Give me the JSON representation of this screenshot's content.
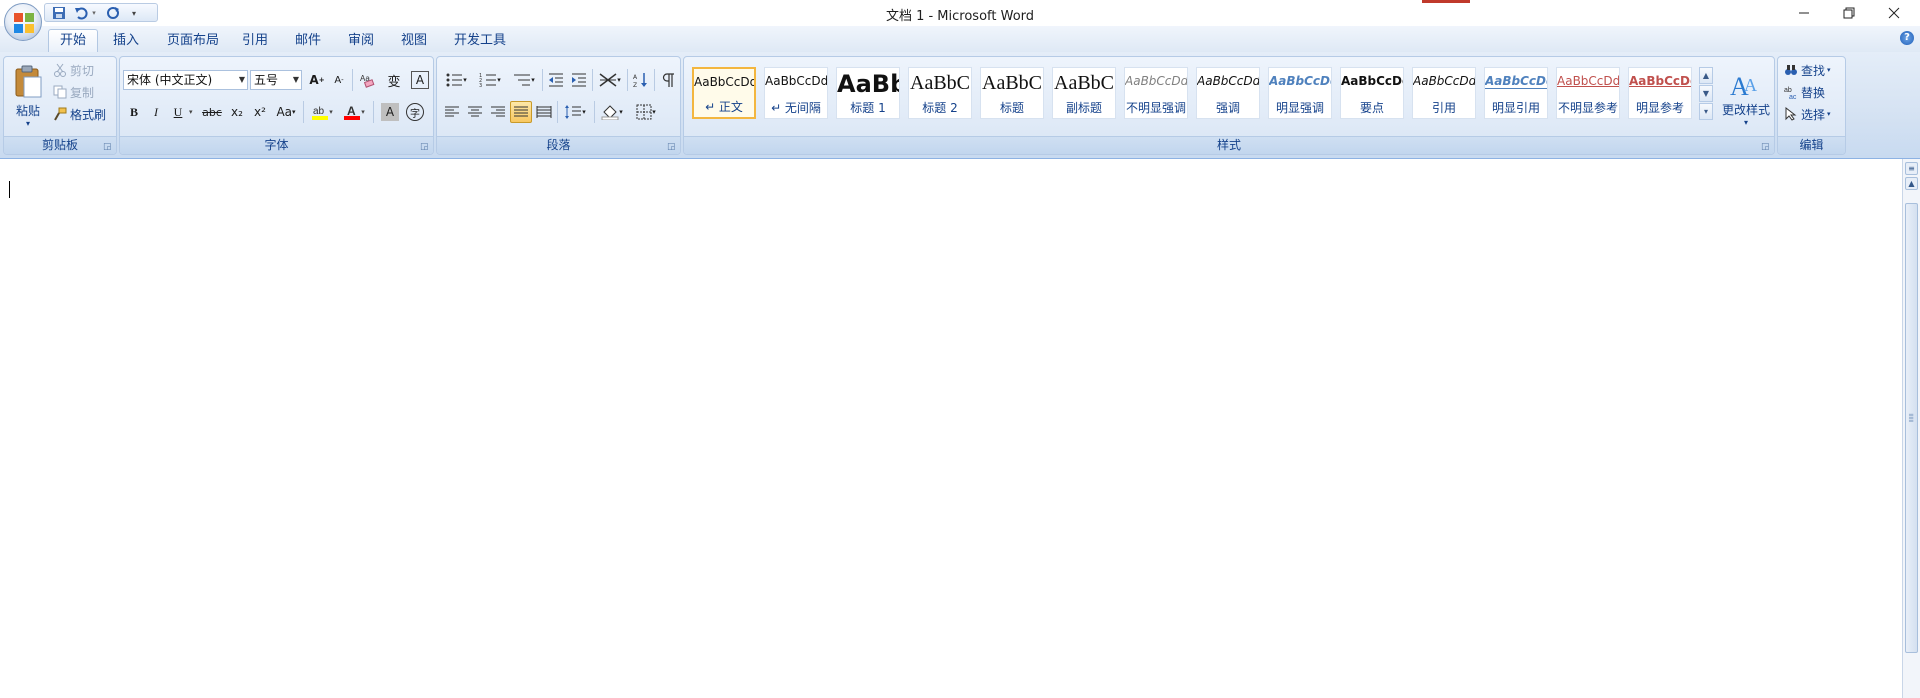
{
  "window": {
    "title": "文档 1 - Microsoft Word",
    "controls": [
      "minimize",
      "restore",
      "close"
    ]
  },
  "tabs": [
    {
      "label": "开始",
      "active": true
    },
    {
      "label": "插入"
    },
    {
      "label": "页面布局"
    },
    {
      "label": "引用"
    },
    {
      "label": "邮件"
    },
    {
      "label": "审阅"
    },
    {
      "label": "视图"
    },
    {
      "label": "开发工具"
    }
  ],
  "clipboard": {
    "group_label": "剪贴板",
    "paste": "粘贴",
    "cut": "剪切",
    "copy": "复制",
    "format_painter": "格式刷"
  },
  "font": {
    "group_label": "字体",
    "font_name": "宋体 (中文正文)",
    "font_size": "五号",
    "grow": "A",
    "shrink": "A",
    "bold": "B",
    "italic": "I",
    "underline": "U",
    "strikethrough": "abc",
    "subscript": "x₂",
    "superscript": "x²",
    "change_case": "Aa",
    "font_color_letter": "A",
    "char_shading": "A",
    "char_border": "A",
    "enclose": "字",
    "phonetic": "变",
    "highlight_color": "#ffff00",
    "font_color": "#ff0000"
  },
  "paragraph": {
    "group_label": "段落"
  },
  "styles": {
    "group_label": "样式",
    "change_styles": "更改样式",
    "items": [
      {
        "sample": "AaBbCcDd",
        "name": "↵ 正文",
        "selected": true
      },
      {
        "sample": "AaBbCcDd",
        "name": "↵ 无间隔"
      },
      {
        "sample": "AaBb",
        "name": "标题 1"
      },
      {
        "sample": "AaBbC",
        "name": "标题 2"
      },
      {
        "sample": "AaBbC",
        "name": "标题"
      },
      {
        "sample": "AaBbC",
        "name": "副标题"
      },
      {
        "sample": "AaBbCcDd",
        "name": "不明显强调"
      },
      {
        "sample": "AaBbCcDd",
        "name": "强调"
      },
      {
        "sample": "AaBbCcDd",
        "name": "明显强调"
      },
      {
        "sample": "AaBbCcDd",
        "name": "要点"
      },
      {
        "sample": "AaBbCcDd",
        "name": "引用"
      },
      {
        "sample": "AaBbCcDd",
        "name": "明显引用"
      },
      {
        "sample": "AaBbCcDd",
        "name": "不明显参考"
      },
      {
        "sample": "AaBbCcDd",
        "name": "明显参考"
      }
    ]
  },
  "editing": {
    "group_label": "编辑",
    "find": "查找",
    "replace": "替换",
    "select": "选择"
  },
  "colors": {
    "accent": "#15428b",
    "ribbon": "#d6e3f3",
    "selected_style_border": "#f3b63f"
  }
}
